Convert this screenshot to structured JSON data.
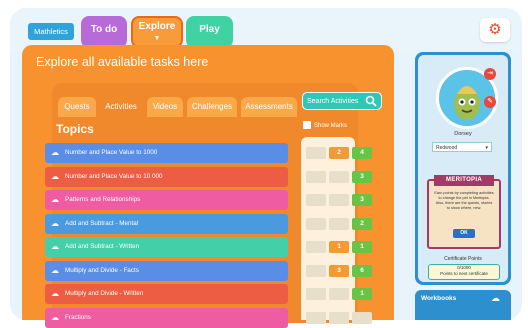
{
  "header": {
    "logo": "Mathletics",
    "nav": [
      "To do",
      "Explore",
      "Play"
    ],
    "settings_icon": "gear-icon"
  },
  "main": {
    "title": "Explore all available tasks here",
    "tabs": [
      "Quests",
      "Activities",
      "Videos",
      "Challenges",
      "Assessments"
    ],
    "active_tab": "Activities",
    "search_label": "Search Activities",
    "topics_heading": "Topics",
    "show_marks_label": "Show Marks"
  },
  "topics": [
    {
      "label": "Number and Place Value to 1000",
      "color": "#5a8ee6",
      "scores": [
        "",
        "2",
        "4"
      ]
    },
    {
      "label": "Number and Place Value to 10 000",
      "color": "#ec5d43",
      "scores": [
        "",
        "",
        "3"
      ]
    },
    {
      "label": "Patterns and Relationships",
      "color": "#ef5ca2",
      "scores": [
        "",
        "",
        "3"
      ]
    },
    {
      "label": "Add and Subtract - Mental",
      "color": "#4a9ae0",
      "scores": [
        "",
        "",
        "2"
      ]
    },
    {
      "label": "Add and Subtract - Written",
      "color": "#43cfa8",
      "scores": [
        "",
        "1",
        "1"
      ]
    },
    {
      "label": "Multiply and Divide - Facts",
      "color": "#5a8ee6",
      "scores": [
        "",
        "3",
        "6"
      ]
    },
    {
      "label": "Multiply and Divide - Written",
      "color": "#ec5d43",
      "scores": [
        "",
        "",
        "1"
      ]
    },
    {
      "label": "Fractions",
      "color": "#ef5ca2",
      "scores": [
        "",
        "",
        ""
      ]
    }
  ],
  "sidebar": {
    "username": "Dorsey",
    "school": "Redwood",
    "meritopia": {
      "title": "MERITOPIA",
      "text": "Earn points by completing activities to change the pet in Meritopia. Also, there are the quests, stories to show where, new.",
      "ok": "OK"
    },
    "certificate_label": "Certificate Points",
    "certificate_value": "0/1000",
    "certificate_sub": "Points to next certificate",
    "workbooks": "Workbooks"
  }
}
